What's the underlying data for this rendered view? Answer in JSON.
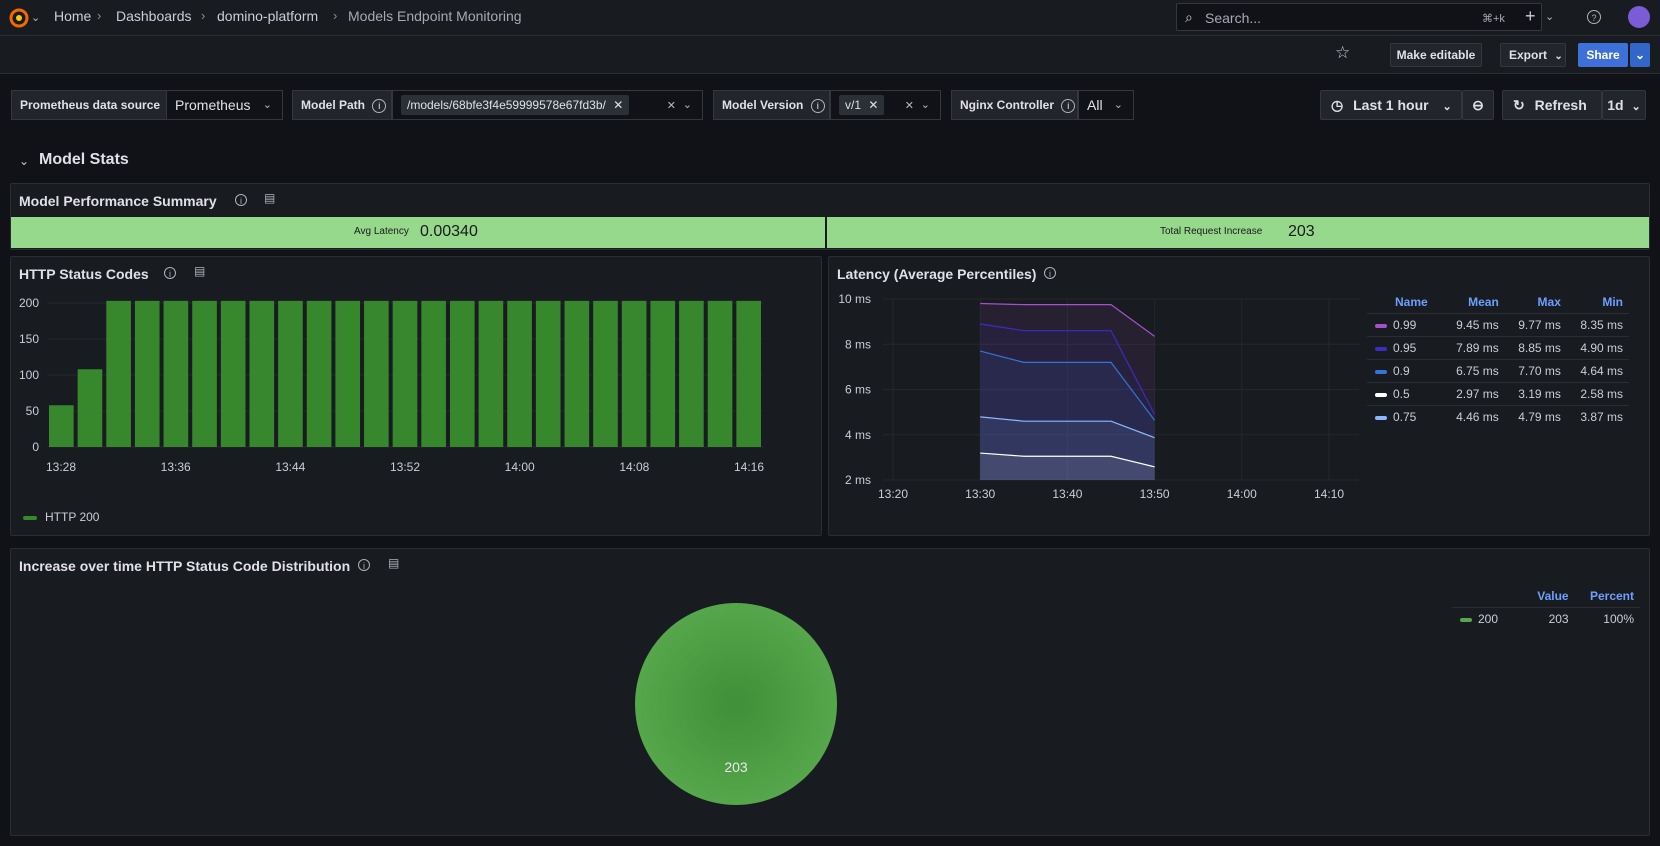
{
  "breadcrumbs": [
    "Home",
    "Dashboards",
    "domino-platform",
    "Models Endpoint Monitoring"
  ],
  "search": {
    "placeholder": "Search...",
    "shortcut": "⌘+k"
  },
  "toolbar": {
    "make_editable": "Make editable",
    "export": "Export",
    "share": "Share"
  },
  "variables": {
    "datasource_label": "Prometheus data source",
    "datasource_value": "Prometheus",
    "model_path_label": "Model Path",
    "model_path_value": "/models/68bfe3f4e59999578e67fd3b/",
    "model_version_label": "Model Version",
    "model_version_value": "v/1",
    "nginx_label": "Nginx Controller",
    "nginx_value": "All"
  },
  "time": {
    "range": "Last 1 hour",
    "refresh": "Refresh",
    "interval": "1d"
  },
  "row": {
    "title": "Model Stats"
  },
  "summary": {
    "title": "Model Performance Summary",
    "stats": [
      {
        "label": "Avg Latency",
        "value": "0.00340"
      },
      {
        "label": "Total Request Increase",
        "value": "203"
      }
    ],
    "color": "#96d98d"
  },
  "chart_data": [
    {
      "type": "bar",
      "title": "HTTP Status Codes",
      "series": [
        {
          "name": "HTTP 200",
          "color": "#37872d",
          "values": [
            58,
            108,
            203,
            203,
            203,
            203,
            203,
            203,
            203,
            203,
            203,
            203,
            203,
            203,
            203,
            203,
            203,
            203,
            203,
            203,
            203,
            203,
            203,
            203,
            203
          ]
        }
      ],
      "ylim": [
        0,
        200
      ],
      "yticks": [
        "200",
        "150",
        "100",
        "50",
        "0"
      ],
      "xtick_labels": [
        "13:28",
        "13:36",
        "13:44",
        "13:52",
        "14:00",
        "14:08",
        "14:16"
      ],
      "legend": "bottom-left"
    },
    {
      "type": "line",
      "title": "Latency (Average Percentiles)",
      "x_labels": [
        "13:20",
        "13:30",
        "13:40",
        "13:50",
        "14:00",
        "14:10"
      ],
      "yticks": [
        "10 ms",
        "8 ms",
        "6 ms",
        "4 ms",
        "2 ms"
      ],
      "ylim": [
        2,
        10
      ],
      "x": [
        "13:30",
        "13:35",
        "13:45",
        "13:50"
      ],
      "series": [
        {
          "name": "0.99",
          "color": "#a352cc",
          "values": [
            9.8,
            9.75,
            9.75,
            8.35
          ],
          "mean": "9.45 ms",
          "max": "9.77 ms",
          "min": "8.35 ms"
        },
        {
          "name": "0.95",
          "color": "#3b2dbf",
          "values": [
            8.9,
            8.6,
            8.6,
            4.9
          ],
          "mean": "7.89 ms",
          "max": "8.85 ms",
          "min": "4.90 ms"
        },
        {
          "name": "0.9",
          "color": "#3274d9",
          "values": [
            7.7,
            7.2,
            7.2,
            4.64
          ],
          "mean": "6.75 ms",
          "max": "7.70 ms",
          "min": "4.64 ms"
        },
        {
          "name": "0.5",
          "color": "#ffffff",
          "values": [
            3.19,
            3.05,
            3.05,
            2.58
          ],
          "mean": "2.97 ms",
          "max": "3.19 ms",
          "min": "2.58 ms"
        },
        {
          "name": "0.75",
          "color": "#8ab8ff",
          "values": [
            4.79,
            4.6,
            4.6,
            3.87
          ],
          "mean": "4.46 ms",
          "max": "4.79 ms",
          "min": "3.87 ms"
        }
      ],
      "legend_headers": [
        "Name",
        "Mean",
        "Max",
        "Min"
      ],
      "legend": "right"
    },
    {
      "type": "pie",
      "title": "Increase over time HTTP Status Code Distribution",
      "slices": [
        {
          "name": "200",
          "value": 203,
          "percent": "100%",
          "color": "#56a64b"
        }
      ],
      "slice_label": "203",
      "legend_headers": [
        "Value",
        "Percent"
      ],
      "legend": "right"
    }
  ]
}
